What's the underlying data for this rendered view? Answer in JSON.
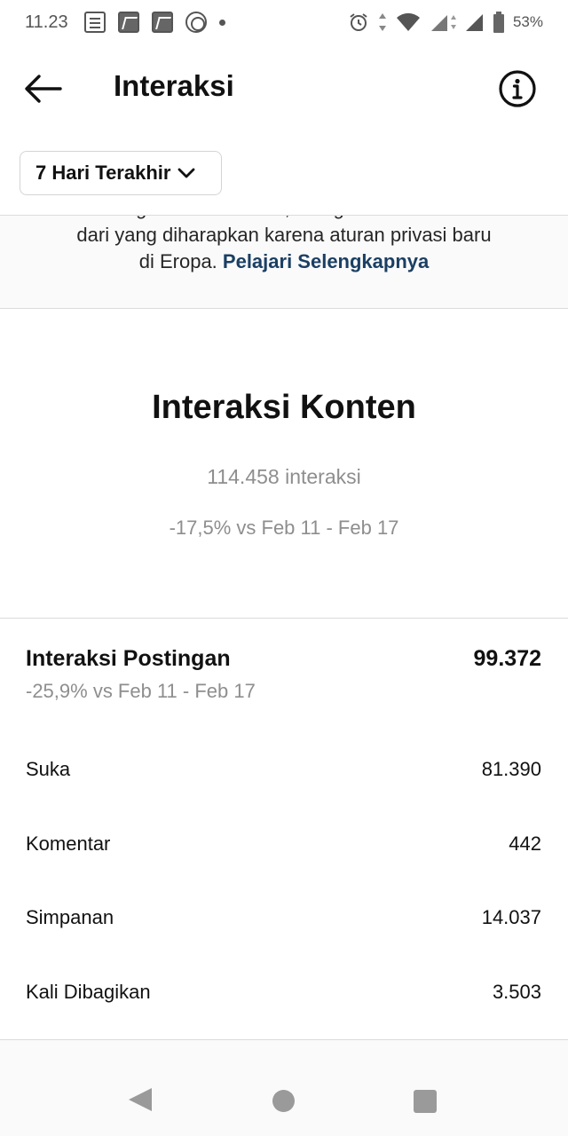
{
  "status_bar": {
    "time": "11.23",
    "battery": "53%"
  },
  "header": {
    "title": "Interaksi",
    "back_icon": "arrow-left-icon",
    "info_icon": "info-circle-icon"
  },
  "period_filter": {
    "label": "7 Hari Terakhir",
    "icon": "chevron-down-icon"
  },
  "notice": {
    "text_line1": "berbagi dan membalas, mungkin lebih rendah",
    "text_line2": "dari yang diharapkan karena aturan privasi baru",
    "text_line3_prefix": "di Eropa. ",
    "link": "Pelajari Selengkapnya"
  },
  "summary": {
    "title": "Interaksi Konten",
    "count": "114.458 interaksi",
    "change": "-17,5% vs Feb 11 - Feb 17"
  },
  "posts": {
    "title": "Interaksi Postingan",
    "value": "99.372",
    "change": "-25,9% vs Feb 11 - Feb 17",
    "metrics": [
      {
        "label": "Suka",
        "value": "81.390"
      },
      {
        "label": "Komentar",
        "value": "442"
      },
      {
        "label": "Simpanan",
        "value": "14.037"
      },
      {
        "label": "Kali Dibagikan",
        "value": "3.503"
      }
    ]
  },
  "colors": {
    "link": "#1b3f63",
    "muted_text": "#8e8e8e",
    "divider": "#dbdbdb"
  }
}
